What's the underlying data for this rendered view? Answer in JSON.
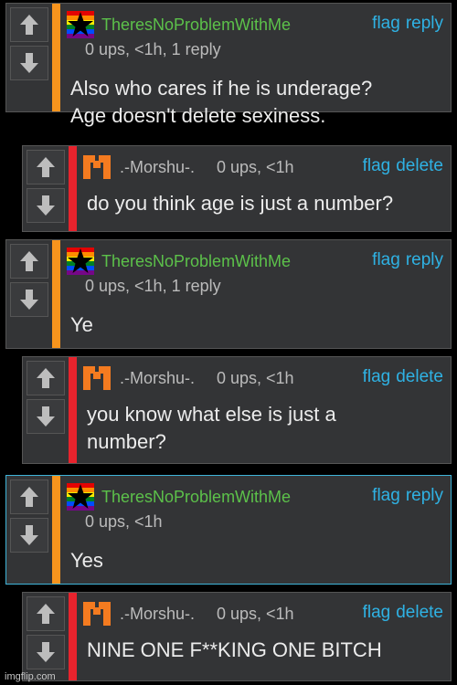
{
  "comments": [
    {
      "username": "TheresNoProblemWithMe",
      "stats": "0 ups, <1h, 1 reply",
      "flag": "flag",
      "action": "reply",
      "text_lines": [
        "Also who cares if he is underage?",
        "Age doesn't delete sexiness."
      ],
      "bar_color": "#f7941d",
      "avatar_icon": "rainbow-flag-star-icon"
    },
    {
      "username": ".-Morshu-.",
      "stats": "0 ups, <1h",
      "flag": "flag",
      "action": "delete",
      "text_lines": [
        "do you think age is just a number?"
      ],
      "bar_color": "#e8232d",
      "avatar_icon": "orange-m-icon"
    },
    {
      "username": "TheresNoProblemWithMe",
      "stats": "0 ups, <1h, 1 reply",
      "flag": "flag",
      "action": "reply",
      "text_lines": [
        "Ye"
      ],
      "bar_color": "#f7941d",
      "avatar_icon": "rainbow-flag-star-icon"
    },
    {
      "username": ".-Morshu-.",
      "stats": "0 ups, <1h",
      "flag": "flag",
      "action": "delete",
      "text_lines": [
        "you know what else is just a",
        "number?"
      ],
      "bar_color": "#e8232d",
      "avatar_icon": "orange-m-icon"
    },
    {
      "username": "TheresNoProblemWithMe",
      "stats": "0 ups, <1h",
      "flag": "flag",
      "action": "reply",
      "text_lines": [
        "Yes"
      ],
      "bar_color": "#f7941d",
      "avatar_icon": "rainbow-flag-star-icon"
    },
    {
      "username": ".-Morshu-.",
      "stats": "0 ups, <1h",
      "flag": "flag",
      "action": "delete",
      "text_lines": [
        "NINE ONE F**KING ONE BITCH"
      ],
      "bar_color": "#e8232d",
      "avatar_icon": "orange-m-icon"
    }
  ],
  "watermark": "imgflip.com"
}
